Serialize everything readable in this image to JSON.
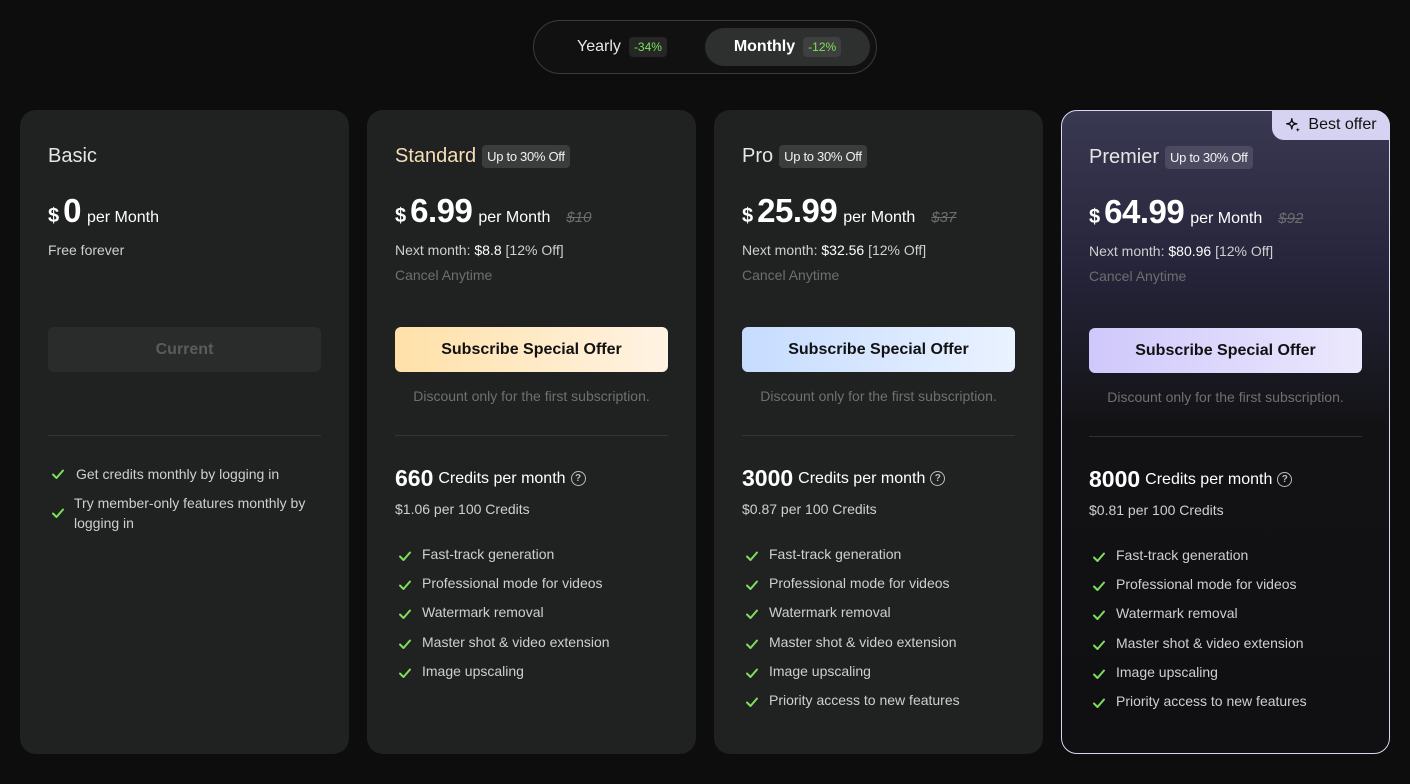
{
  "billing_toggle": {
    "yearly": {
      "label": "Yearly",
      "badge": "-34%"
    },
    "monthly": {
      "label": "Monthly",
      "badge": "-12%",
      "selected": true
    }
  },
  "colors": {
    "check": "#7ee05a",
    "discount_badge_text": "#7ee05a",
    "standard_cta": "#ffe1a8",
    "pro_cta": "#c6dcff",
    "premier_cta": "#cfc8fb"
  },
  "plans": {
    "basic": {
      "name": "Basic",
      "currency": "$",
      "price": "0",
      "per": "per Month",
      "subtitle": "Free forever",
      "cta": "Current",
      "features": [
        "Get credits monthly by logging in",
        "Try member-only features monthly by logging in"
      ]
    },
    "standard": {
      "name": "Standard",
      "badge": "Up to 30% Off",
      "currency": "$",
      "price": "6.99",
      "per": "per Month",
      "original_price": "$10",
      "next_month_label": "Next month: ",
      "next_month_price": "$8.8",
      "next_month_discount": " [12% Off]",
      "cancel": "Cancel Anytime",
      "cta": "Subscribe Special Offer",
      "discount_note": "Discount only for the first subscription.",
      "credits": "660",
      "credits_label": "Credits per month",
      "per_credit": "$1.06 per 100 Credits",
      "features": [
        "Fast-track generation",
        "Professional mode for videos",
        "Watermark removal",
        "Master shot & video extension",
        "Image upscaling"
      ]
    },
    "pro": {
      "name": "Pro",
      "badge": "Up to 30% Off",
      "currency": "$",
      "price": "25.99",
      "per": "per Month",
      "original_price": "$37",
      "next_month_label": "Next month: ",
      "next_month_price": "$32.56",
      "next_month_discount": " [12% Off]",
      "cancel": "Cancel Anytime",
      "cta": "Subscribe Special Offer",
      "discount_note": "Discount only for the first subscription.",
      "credits": "3000",
      "credits_label": "Credits per month",
      "per_credit": "$0.87 per 100 Credits",
      "features": [
        "Fast-track generation",
        "Professional mode for videos",
        "Watermark removal",
        "Master shot & video extension",
        "Image upscaling",
        "Priority access to new features"
      ]
    },
    "premier": {
      "ribbon": "Best offer",
      "name": "Premier",
      "badge": "Up to 30% Off",
      "currency": "$",
      "price": "64.99",
      "per": "per Month",
      "original_price": "$92",
      "next_month_label": "Next month: ",
      "next_month_price": "$80.96",
      "next_month_discount": " [12% Off]",
      "cancel": "Cancel Anytime",
      "cta": "Subscribe Special Offer",
      "discount_note": "Discount only for the first subscription.",
      "credits": "8000",
      "credits_label": "Credits per month",
      "per_credit": "$0.81 per 100 Credits",
      "features": [
        "Fast-track generation",
        "Professional mode for videos",
        "Watermark removal",
        "Master shot & video extension",
        "Image upscaling",
        "Priority access to new features"
      ]
    }
  }
}
